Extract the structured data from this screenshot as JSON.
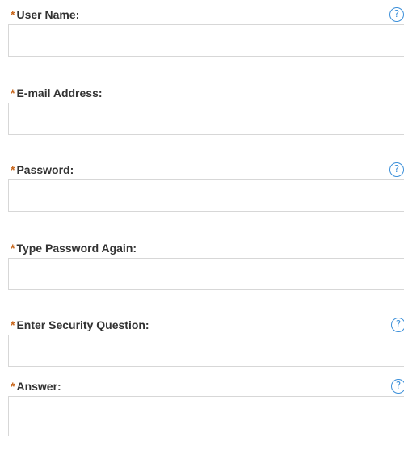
{
  "required_marker": "*",
  "help_glyph": "?",
  "colors": {
    "required": "#c8661b",
    "help_icon": "#3b8fd9",
    "input_border": "#d7d7d7",
    "label": "#333333"
  },
  "fields": [
    {
      "label": "User Name:",
      "value": "",
      "placeholder": "",
      "help_icon": "question-icon"
    },
    {
      "label": "E-mail Address:",
      "value": "",
      "placeholder": ""
    },
    {
      "label": "Password:",
      "value": "",
      "placeholder": "",
      "help_icon": "question-icon"
    },
    {
      "label": "Type Password Again:",
      "value": "",
      "placeholder": ""
    },
    {
      "label": "Enter Security Question:",
      "value": "",
      "placeholder": "",
      "help_icon": "question-icon"
    },
    {
      "label": "Answer:",
      "value": "",
      "placeholder": "",
      "help_icon": "question-icon"
    }
  ]
}
